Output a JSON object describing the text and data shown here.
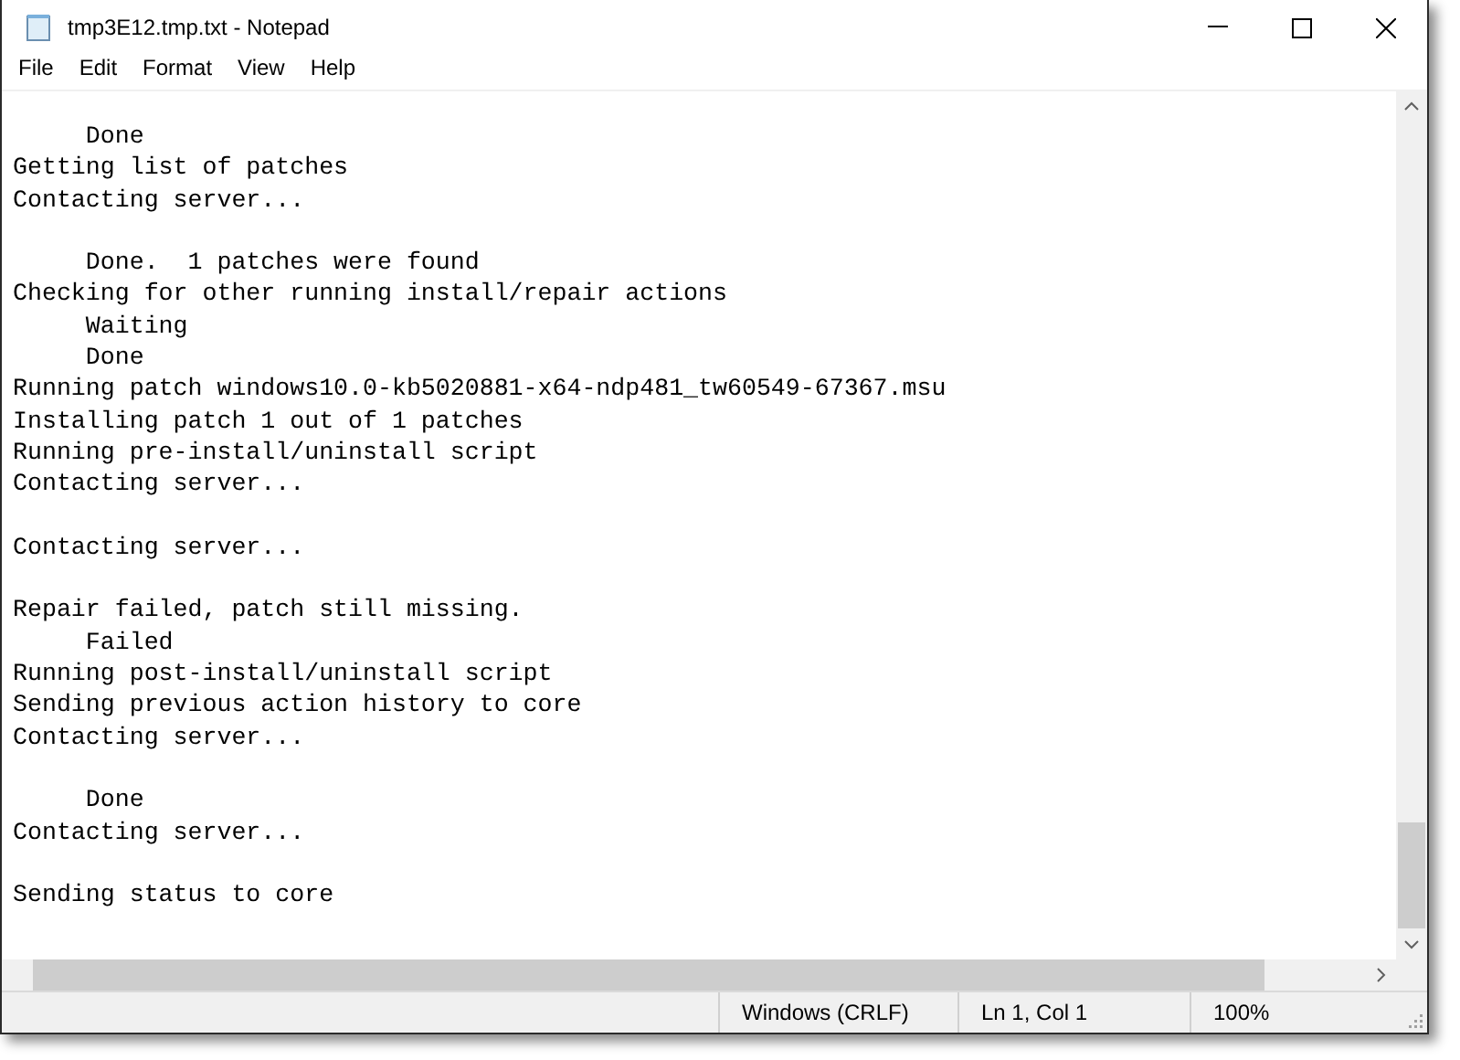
{
  "window": {
    "title": "tmp3E12.tmp.txt - Notepad"
  },
  "menu": [
    "File",
    "Edit",
    "Format",
    "View",
    "Help"
  ],
  "editor": {
    "text": "     Done\nGetting list of patches\nContacting server...\n\n     Done.  1 patches were found\nChecking for other running install/repair actions\n     Waiting\n     Done\nRunning patch windows10.0-kb5020881-x64-ndp481_tw60549-67367.msu\nInstalling patch 1 out of 1 patches\nRunning pre-install/uninstall script\nContacting server...\n\nContacting server...\n\nRepair failed, patch still missing.\n     Failed\nRunning post-install/uninstall script\nSending previous action history to core\nContacting server...\n\n     Done\nContacting server...\n\nSending status to core"
  },
  "status_bar": [
    "Windows (CRLF)",
    "Ln 1, Col 1",
    "100%"
  ]
}
